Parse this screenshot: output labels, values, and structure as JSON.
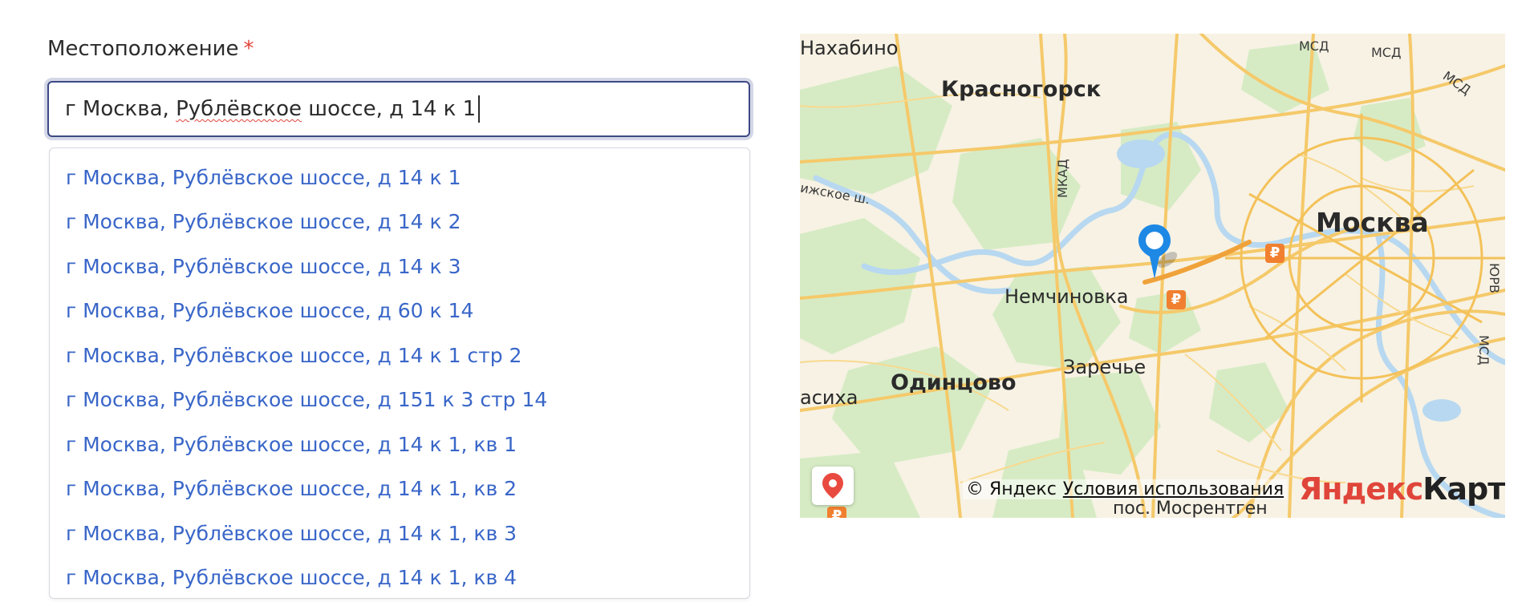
{
  "form": {
    "label": "Местоположение",
    "required_mark": "*",
    "input": {
      "before": "г Москва, ",
      "misspelled": "Рублёвское",
      "after": " шоссе, д 14 к 1"
    }
  },
  "suggestions": [
    "г Москва, Рублёвское шоссе, д 14 к 1",
    "г Москва, Рублёвское шоссе, д 14 к 2",
    "г Москва, Рублёвское шоссе, д 14 к 3",
    "г Москва, Рублёвское шоссе, д 60 к 14",
    "г Москва, Рублёвское шоссе, д 14 к 1 стр 2",
    "г Москва, Рублёвское шоссе, д 151 к 3 стр 14",
    "г Москва, Рублёвское шоссе, д 14 к 1, кв 1",
    "г Москва, Рублёвское шоссе, д 14 к 1, кв 2",
    "г Москва, Рублёвское шоссе, д 14 к 1, кв 3",
    "г Москва, Рублёвское шоссе, д 14 к 1, кв 4"
  ],
  "map": {
    "places": {
      "nakhabino": "Нахабино",
      "krasnogorsk": "Красногорск",
      "moskva": "Москва",
      "nemchinovka": "Немчиновка",
      "odintsovo": "Одинцово",
      "zarechye": "Заречье",
      "vlasikha": "асиха",
      "mosrentgen": "пос. Мосрентген"
    },
    "roads": {
      "mkad": "МКАД",
      "msd_1": "МСД",
      "msd_2": "МСД",
      "msd_3": "МСД",
      "msd_4": "МСД",
      "yur": "ЮРВ",
      "ilinskoe": "ижское ш."
    },
    "metro_symbol": "₽",
    "copyright": "© Яндекс",
    "terms_link": "Условия использования",
    "brand_part1": "Яндекс",
    "brand_part2": "Карты"
  },
  "colors": {
    "accent": "#3966c8",
    "input_border": "#3d4a86",
    "required": "#e0453a",
    "marker": "#1e88e5"
  },
  "icons": {
    "marker": "map-marker-icon",
    "geolocation": "geolocation-pin-icon",
    "metro": "metro-icon"
  }
}
